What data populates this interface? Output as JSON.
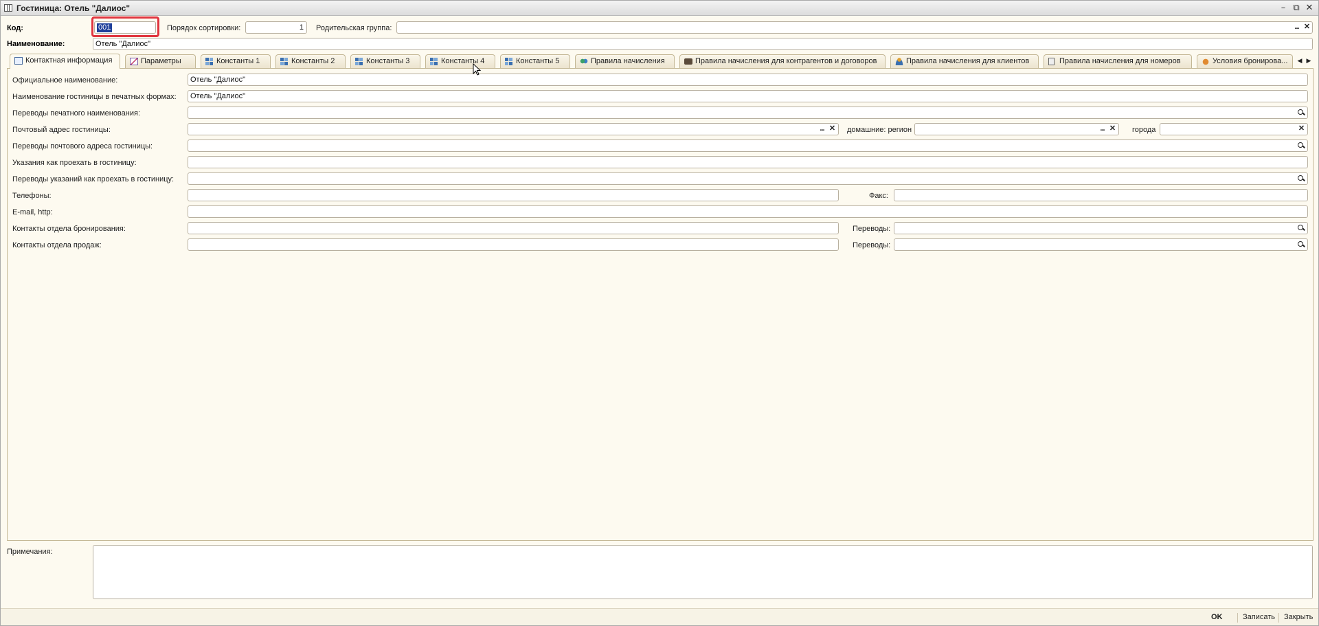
{
  "window": {
    "title": "Гостиница: Отель \"Далиос\"",
    "controls": [
      "–",
      "⧉",
      "✕"
    ]
  },
  "header": {
    "code_label": "Код:",
    "code_value": "001",
    "sort_label": "Порядок сортировки:",
    "sort_value": "1",
    "parent_label": "Родительская группа:",
    "parent_value": "",
    "name_label": "Наименование:",
    "name_value": "Отель \"Далиос\""
  },
  "tabs": [
    {
      "label": "Контактная информация",
      "icon": "doc",
      "active": true
    },
    {
      "label": "Параметры",
      "icon": "chart"
    },
    {
      "label": "Константы 1",
      "icon": "blocks"
    },
    {
      "label": "Константы 2",
      "icon": "blocks"
    },
    {
      "label": "Константы 3",
      "icon": "blocks"
    },
    {
      "label": "Константы 4",
      "icon": "blocks"
    },
    {
      "label": "Константы 5",
      "icon": "blocks"
    },
    {
      "label": "Правила начисления",
      "icon": "money"
    },
    {
      "label": "Правила начисления для контрагентов и договоров",
      "icon": "case"
    },
    {
      "label": "Правила начисления для клиентов",
      "icon": "person"
    },
    {
      "label": "Правила начисления для номеров",
      "icon": "door"
    },
    {
      "label": "Условия бронирова...",
      "icon": "hands"
    }
  ],
  "contact": {
    "official_name_label": "Официальное наименование:",
    "official_name_value": "Отель \"Далиос\"",
    "print_name_label": "Наименование гостиницы в печатных формах:",
    "print_name_value": "Отель \"Далиос\"",
    "print_name_translations_label": "Переводы печатного наименования:",
    "postal_address_label": "Почтовый адрес гостиницы:",
    "home_region_label": "домашние: регион",
    "city_label": "города",
    "postal_translations_label": "Переводы почтового адреса гостиницы:",
    "directions_label": "Указания как проехать в гостиницу:",
    "directions_translations_label": "Переводы указаний как проехать в гостиницу:",
    "phones_label": "Телефоны:",
    "fax_label": "Факс:",
    "email_label": "E-mail, http:",
    "booking_contacts_label": "Контакты отдела бронирования:",
    "sales_contacts_label": "Контакты отдела продаж:",
    "translations_label": "Переводы:"
  },
  "notes_label": "Примечания:",
  "buttons": {
    "ok": "OK",
    "save": "Записать",
    "close": "Закрыть"
  }
}
